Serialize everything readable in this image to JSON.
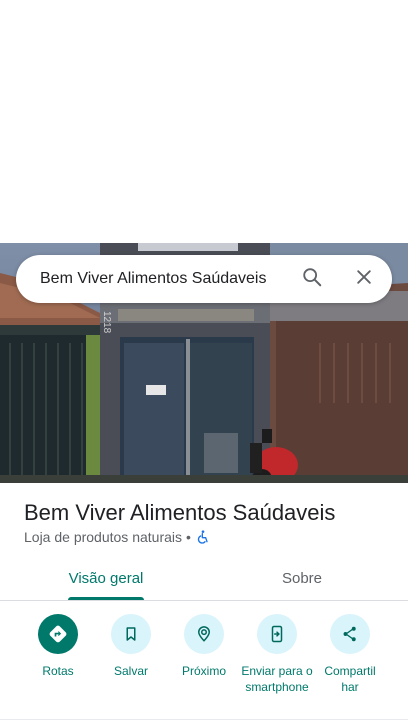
{
  "search": {
    "query": "Bem Viver Alimentos Saúdaveis"
  },
  "place": {
    "name": "Bem Viver Alimentos Saúdaveis",
    "category": "Loja de produtos naturais",
    "separator": "•",
    "house_number": "1218"
  },
  "tabs": [
    {
      "label": "Visão geral",
      "selected": true
    },
    {
      "label": "Sobre",
      "selected": false
    }
  ],
  "actions": [
    {
      "label": "Rotas",
      "icon": "directions-icon",
      "primary": true
    },
    {
      "label": "Salvar",
      "icon": "bookmark-icon",
      "primary": false
    },
    {
      "label": "Próximo",
      "icon": "nearby-icon",
      "primary": false
    },
    {
      "label": "Enviar para o smartphone",
      "icon": "send-to-phone-icon",
      "primary": false
    },
    {
      "label": "Compartilhar",
      "icon": "share-icon",
      "primary": false
    }
  ],
  "colors": {
    "accent": "#00796b",
    "action_circle": "#d9f4fb",
    "secondary_text": "#5f6368",
    "accessibility": "#1a73e8"
  }
}
